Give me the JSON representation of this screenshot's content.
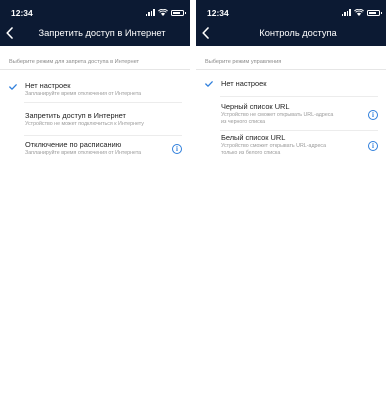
{
  "left": {
    "status_time": "12:34",
    "title": "Запретить доступ в Интернет",
    "section_hint": "Выберите режим для запрета доступа в Интернет",
    "options": [
      {
        "title": "Нет настроек",
        "desc": "Запланируйте время отключения от Интернета",
        "selected": true
      },
      {
        "title": "Запретить доступ в Интернет",
        "desc": "Устройство не может подключиться к Интернету",
        "selected": false
      },
      {
        "title": "Отключение по расписанию",
        "desc": "Запланируйте время отключения от Интернета",
        "selected": false
      }
    ]
  },
  "right": {
    "status_time": "12:34",
    "title": "Контроль доступа",
    "section_hint": "Выберите режим управления",
    "options": [
      {
        "title": "Нет настроек",
        "selected": true
      },
      {
        "title": "Черный список URL",
        "desc_line1": "Устройство не сможет открывать URL-адреса",
        "desc_line2": "из черного списка",
        "selected": false
      },
      {
        "title": "Белый список URL",
        "desc_line1": "Устройство сможет открывать URL-адреса",
        "desc_line2": "только из белого списка",
        "selected": false
      }
    ]
  },
  "icons": {
    "info_glyph": "i"
  },
  "colors": {
    "navbar": "#0c1a33",
    "accent": "#2f7fdc"
  }
}
